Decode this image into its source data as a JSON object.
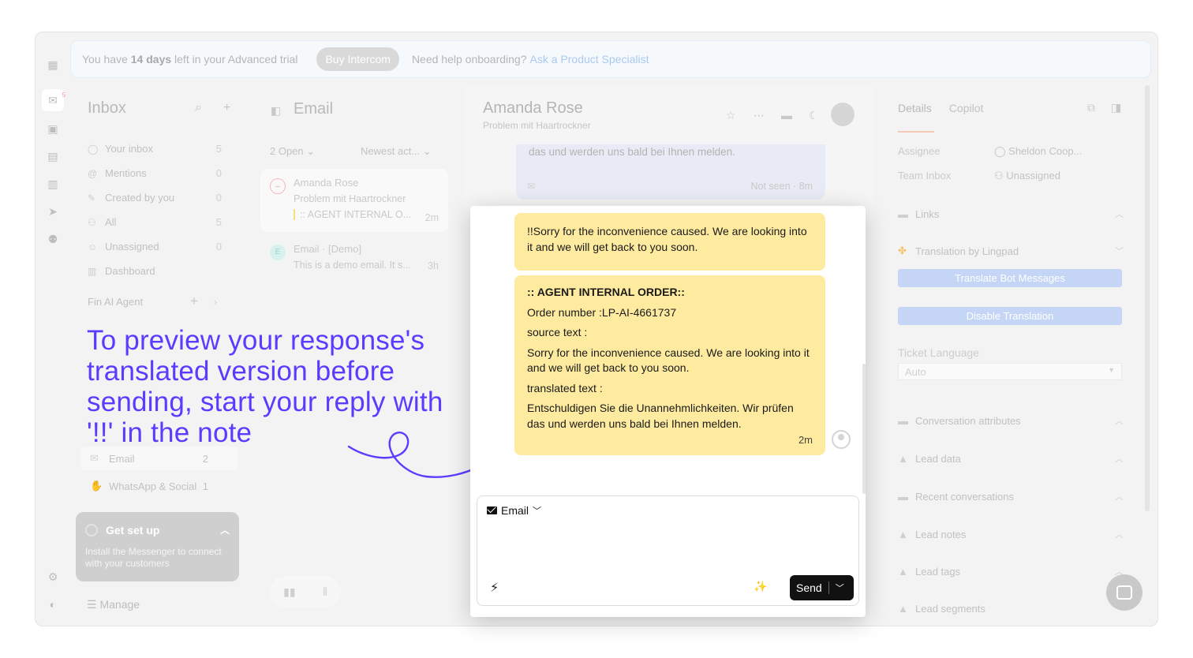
{
  "banner": {
    "prefix": "You have",
    "days": "14 days",
    "suffix": "left in your Advanced trial",
    "buy_button": "Buy Intercom",
    "help": "Need help onboarding?",
    "help_link": "Ask a Product Specialist"
  },
  "rail": {
    "inbox_badge": "5"
  },
  "inbox": {
    "title": "Inbox",
    "items": [
      {
        "label": "Your inbox",
        "count": "5",
        "icon": "avatar-icon"
      },
      {
        "label": "Mentions",
        "count": "0",
        "icon": "at-icon"
      },
      {
        "label": "Created by you",
        "count": "0",
        "icon": "pencil-icon"
      },
      {
        "label": "All",
        "count": "5",
        "icon": "users-icon"
      },
      {
        "label": "Unassigned",
        "count": "0",
        "icon": "unassigned-icon"
      },
      {
        "label": "Dashboard",
        "count": "",
        "icon": "bar-chart-icon"
      }
    ],
    "fin_section": "Fin AI Agent",
    "channels": [
      {
        "label": "Email",
        "count": "2"
      },
      {
        "label": "WhatsApp & Social",
        "count": "1"
      }
    ],
    "manage": "Manage"
  },
  "overlay": {
    "text": "To preview your response's translated version before sending, start your reply with '!!' in the note"
  },
  "getsetup": {
    "title": "Get set up",
    "desc": "Install the Messenger to connect with your customers"
  },
  "email_list": {
    "title": "Email",
    "filter_open": "2 Open",
    "filter_sort": "Newest act...",
    "cards": [
      {
        "avatar": "–",
        "name": "Amanda Rose",
        "subject": "Problem mit Haartrockner",
        "preview": ":: AGENT INTERNAL O...",
        "time": "2m"
      },
      {
        "avatar": "E",
        "name": "Email · [Demo]",
        "subject": "This is a demo email. It s...",
        "preview": "",
        "time": "3h"
      }
    ]
  },
  "conversation": {
    "name": "Amanda Rose",
    "subject": "Problem mit Haartrockner",
    "faded_text": "das und werden uns bald bei Ihnen melden.",
    "faded_status": "Not seen · 8m",
    "bubble1": "!!Sorry for the inconvenience caused. We are looking into it and we will get back to you soon.",
    "bubble2": {
      "heading": ":: AGENT INTERNAL ORDER::",
      "order": "Order number :LP-AI-4661737",
      "source_label": "source text :",
      "source": "Sorry for the inconvenience caused. We are looking into it and we will get back to you soon.",
      "translated_label": "translated text :",
      "translated": "Entschuldigen Sie die Unannehmlichkeiten. Wir prüfen das und werden uns bald bei Ihnen melden.",
      "time": "2m"
    },
    "composer": {
      "channel": "Email",
      "send": "Send"
    }
  },
  "details": {
    "tab_details": "Details",
    "tab_copilot": "Copilot",
    "assignee_label": "Assignee",
    "assignee_value": "Sheldon Coop...",
    "team_label": "Team Inbox",
    "team_value": "Unassigned",
    "links": "Links",
    "translation": "Translation by Lingpad",
    "translate_btn": "Translate Bot Messages",
    "disable_btn": "Disable Translation",
    "ticket_language": "Ticket Language",
    "language_value": "Auto",
    "sections": [
      "Conversation attributes",
      "Lead data",
      "Recent conversations",
      "Lead notes",
      "Lead tags",
      "Lead segments"
    ]
  }
}
